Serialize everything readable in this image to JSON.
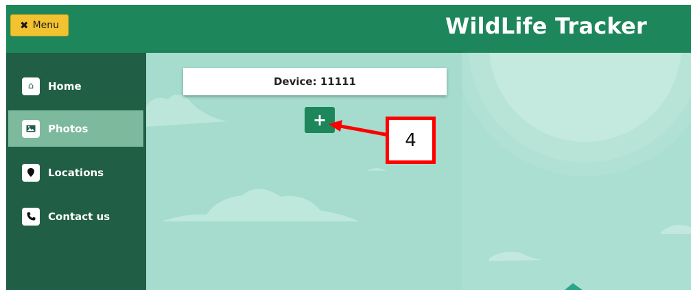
{
  "header": {
    "menu_button": {
      "icon": "close-icon",
      "icon_glyph": "✖",
      "label": "Menu"
    },
    "title": "WildLife Tracker"
  },
  "sidebar": {
    "items": [
      {
        "label": "Home",
        "icon": "home-icon",
        "glyph": "⌂",
        "active": false
      },
      {
        "label": "Photos",
        "icon": "image-icon",
        "glyph": "▰",
        "active": true
      },
      {
        "label": "Locations",
        "icon": "map-pin-icon",
        "glyph": "●",
        "active": false
      },
      {
        "label": "Contact us",
        "icon": "phone-icon",
        "glyph": "✆",
        "active": false
      }
    ]
  },
  "main": {
    "device_label": "Device: 11111",
    "add_button": {
      "icon": "plus-icon",
      "glyph": "+"
    }
  },
  "annotation": {
    "number": "4",
    "color": "#ff0000"
  },
  "colors": {
    "header_green": "#1d875b",
    "sidebar_dark_green": "#205e45",
    "sidebar_active": "#7db99d",
    "menu_yellow": "#f2c230",
    "background_teal": "#a5dccd"
  }
}
